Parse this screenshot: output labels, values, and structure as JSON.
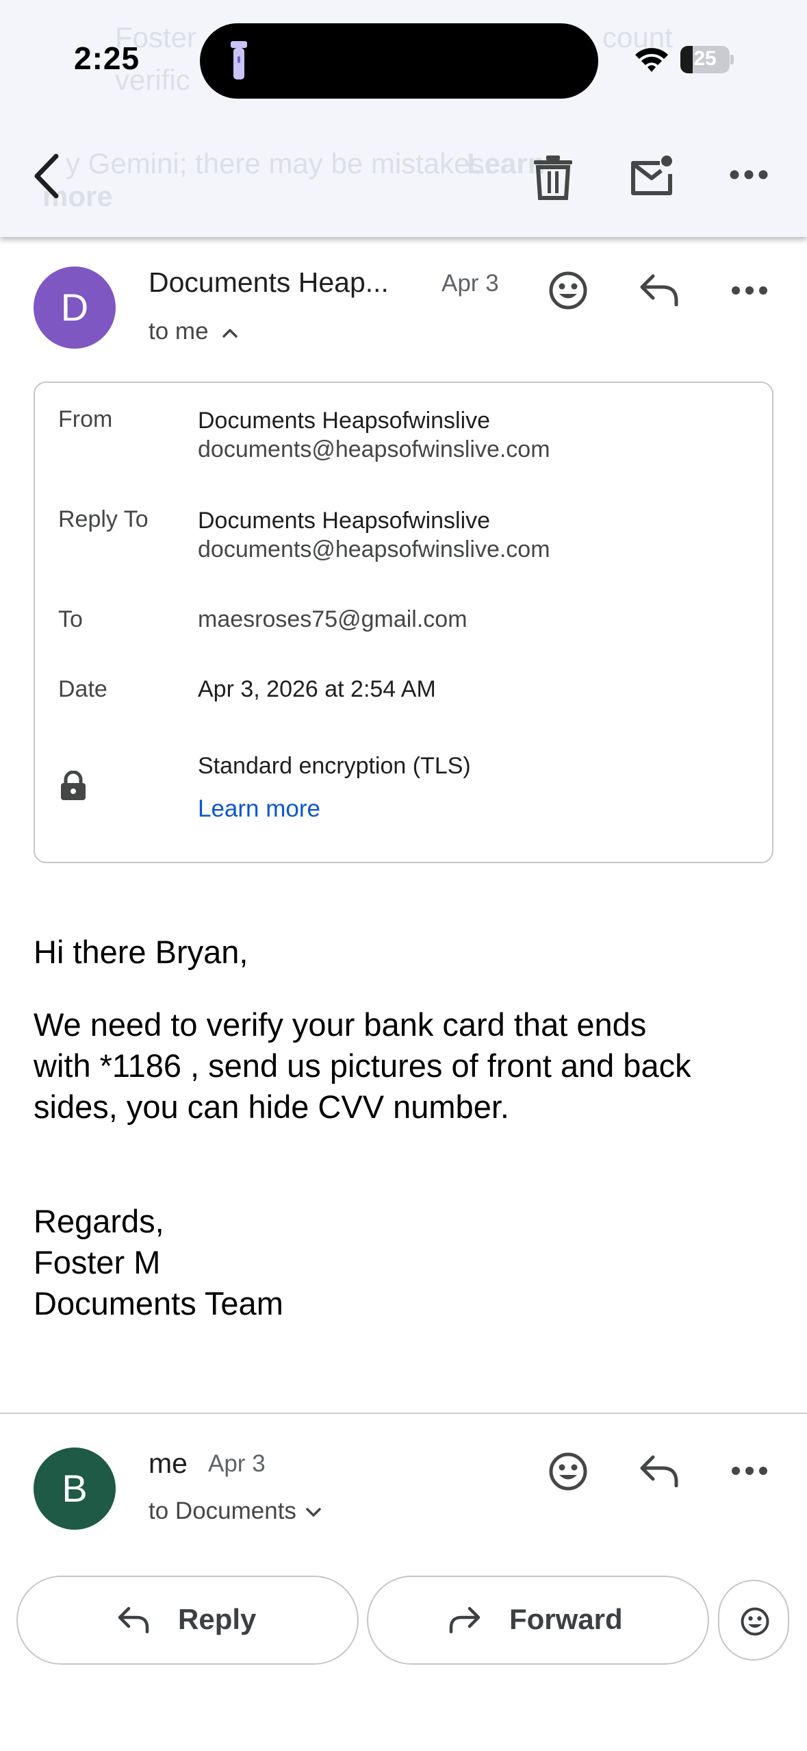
{
  "status_bar": {
    "time": "2:25",
    "battery": "25",
    "battery_level": 0.25
  },
  "background_preview": {
    "line1": "Foster",
    "line1_end": "count",
    "line2": "verific",
    "line3": "y Gemini; there may be mistakes.",
    "line3_bold": "Learn",
    "line4_bold": "more"
  },
  "toolbar": {
    "back_icon": "chevron-left-icon",
    "delete_icon": "trash-icon",
    "mark_unread_icon": "mail-unread-icon",
    "more_icon": "more-horizontal-icon"
  },
  "message1": {
    "avatar_letter": "D",
    "avatar_color": "#7e57c2",
    "sender": "Documents Heap...",
    "date": "Apr 3",
    "recipient_summary": "to me",
    "details": {
      "from_label": "From",
      "from_name": "Documents Heapsofwinslive",
      "from_email": "documents@heapsofwinslive.com",
      "reply_to_label": "Reply To",
      "reply_to_name": "Documents Heapsofwinslive",
      "reply_to_email": "documents@heapsofwinslive.com",
      "to_label": "To",
      "to_value": "maesroses75@gmail.com",
      "date_label": "Date",
      "date_value": "Apr 3, 2026 at 2:54 AM",
      "encryption": "Standard encryption (TLS)",
      "learn_more": "Learn more"
    },
    "body": {
      "greeting": "Hi there Bryan,",
      "paragraph_line1": "We need to verify your bank card that ends",
      "paragraph_line2": "with *1186 , send us pictures of front and back",
      "paragraph_line3": "sides, you can hide CVV number.",
      "signoff": "Regards,",
      "name": "Foster M",
      "team": "Documents Team"
    }
  },
  "message2": {
    "avatar_letter": "B",
    "avatar_color": "#1e5a46",
    "sender": "me",
    "date": "Apr 3",
    "recipient_summary": "to Documents"
  },
  "actions": {
    "reply_label": "Reply",
    "forward_label": "Forward"
  },
  "colors": {
    "link": "#0b57d0",
    "toolbar_bg": "#f3f5fa"
  }
}
